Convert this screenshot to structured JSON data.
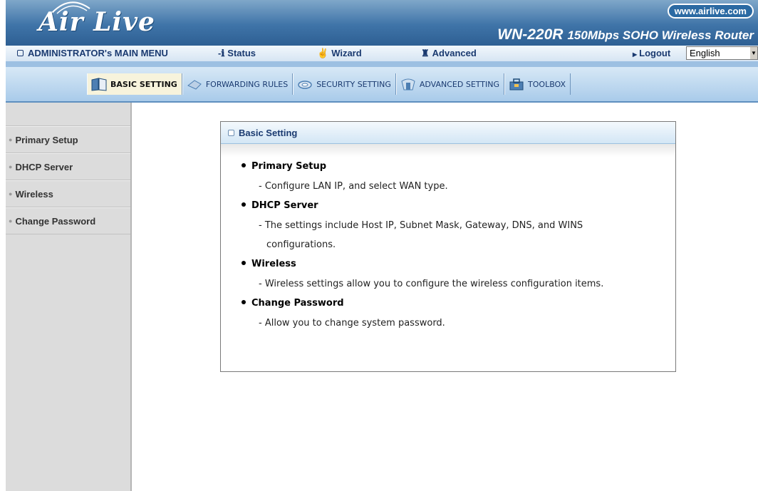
{
  "banner": {
    "logo": "Air Live",
    "url": "www.airlive.com",
    "model": "WN-220R",
    "model_desc": "150Mbps SOHO Wireless Router"
  },
  "menu": {
    "main": "ADMINISTRATOR's MAIN MENU",
    "status": "Status",
    "wizard": "Wizard",
    "advanced": "Advanced",
    "logout": "Logout",
    "language": "English"
  },
  "tabs": [
    {
      "label": "BASIC SETTING",
      "icon": "book-icon",
      "active": true
    },
    {
      "label": "FORWARDING RULES",
      "icon": "arrow-icon"
    },
    {
      "label": "SECURITY SETTING",
      "icon": "lock-icon"
    },
    {
      "label": "ADVANCED SETTING",
      "icon": "advanced-icon"
    },
    {
      "label": "TOOLBOX",
      "icon": "toolbox-icon"
    }
  ],
  "sidebar": {
    "items": [
      {
        "label": "Primary Setup"
      },
      {
        "label": "DHCP Server"
      },
      {
        "label": "Wireless"
      },
      {
        "label": "Change Password"
      }
    ]
  },
  "content": {
    "heading": "Basic Setting",
    "sections": [
      {
        "title": "Primary Setup",
        "desc": "- Configure LAN IP, and select WAN type.",
        "desc2": ""
      },
      {
        "title": "DHCP Server",
        "desc": "- The settings include Host IP, Subnet Mask, Gateway, DNS, and WINS",
        "desc2": "configurations."
      },
      {
        "title": "Wireless",
        "desc": "- Wireless settings allow you to configure the wireless configuration items.",
        "desc2": ""
      },
      {
        "title": "Change Password",
        "desc": "- Allow you to change system password.",
        "desc2": ""
      }
    ]
  },
  "colors": {
    "banner": "#3f74a8",
    "menu_text": "#1a3a70",
    "sidebar_bg": "#dcdcdc",
    "active_tab": "#f7f3dc"
  }
}
